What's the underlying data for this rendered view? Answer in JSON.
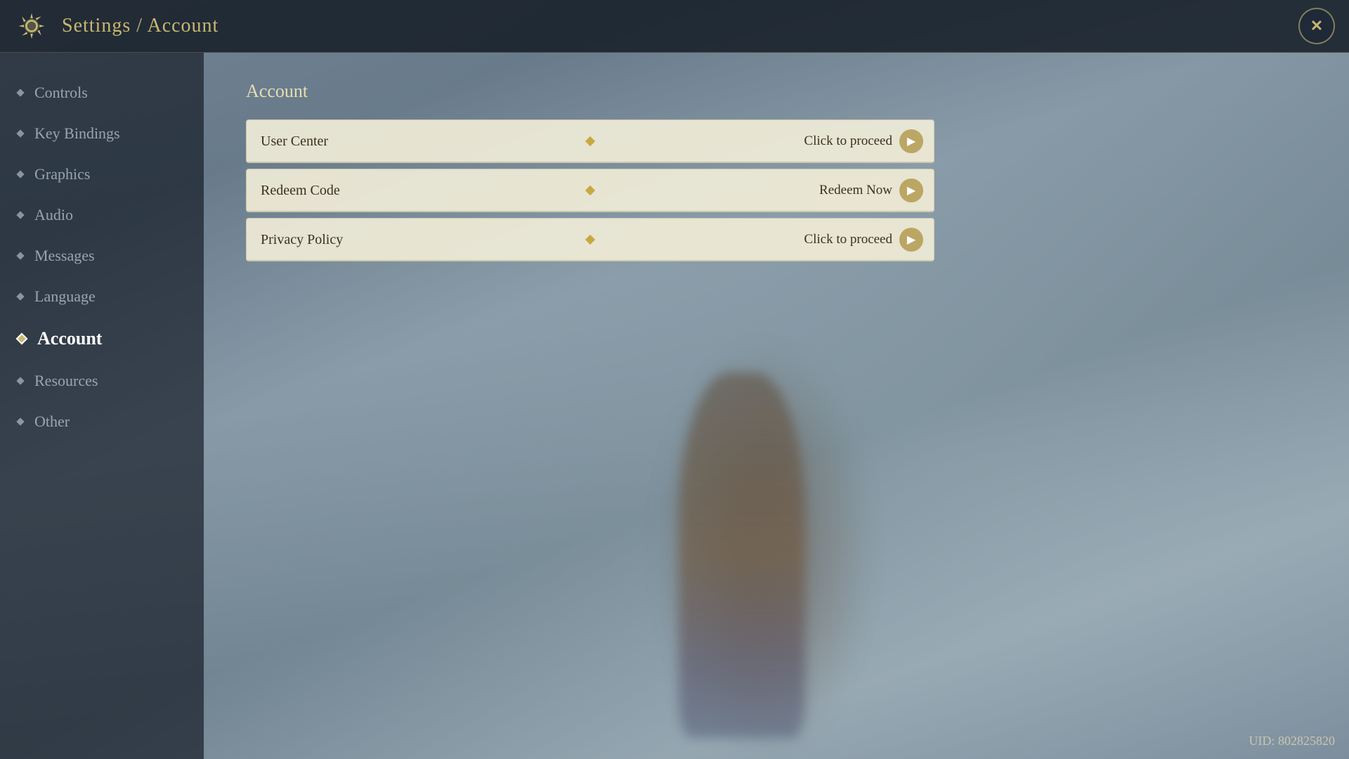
{
  "header": {
    "title": "Settings / Account",
    "close_label": "✕"
  },
  "sidebar": {
    "items": [
      {
        "id": "controls",
        "label": "Controls",
        "active": false
      },
      {
        "id": "key-bindings",
        "label": "Key Bindings",
        "active": false
      },
      {
        "id": "graphics",
        "label": "Graphics",
        "active": false
      },
      {
        "id": "audio",
        "label": "Audio",
        "active": false
      },
      {
        "id": "messages",
        "label": "Messages",
        "active": false
      },
      {
        "id": "language",
        "label": "Language",
        "active": false
      },
      {
        "id": "account",
        "label": "Account",
        "active": true
      },
      {
        "id": "resources",
        "label": "Resources",
        "active": false
      },
      {
        "id": "other",
        "label": "Other",
        "active": false
      }
    ]
  },
  "content": {
    "section_title": "Account",
    "options": [
      {
        "id": "user-center",
        "label": "User Center",
        "action_label": "Click to proceed",
        "arrow": "▶"
      },
      {
        "id": "redeem-code",
        "label": "Redeem Code",
        "action_label": "Redeem Now",
        "arrow": "▶"
      },
      {
        "id": "privacy-policy",
        "label": "Privacy Policy",
        "action_label": "Click to proceed",
        "arrow": "▶"
      }
    ]
  },
  "footer": {
    "uid_label": "UID: 802825820"
  }
}
